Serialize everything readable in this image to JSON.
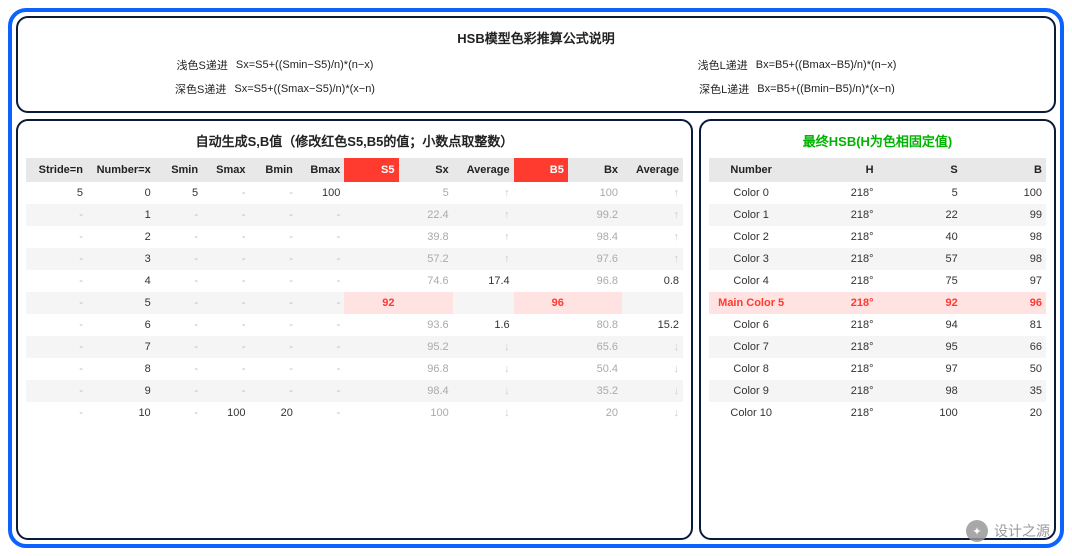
{
  "top": {
    "title": "HSB模型色彩推算公式说明",
    "formulas": [
      {
        "label": "浅色S递进",
        "text": "Sx=S5+((Smin−S5)/n)*(n−x)"
      },
      {
        "label": "浅色L递进",
        "text": "Bx=B5+((Bmax−B5)/n)*(n−x)"
      },
      {
        "label": "深色S递进",
        "text": "Sx=S5+((Smax−S5)/n)*(x−n)"
      },
      {
        "label": "深色L递进",
        "text": "Bx=B5+((Bmin−B5)/n)*(x−n)"
      }
    ]
  },
  "left": {
    "title": "自动生成S,B值（修改红色S5,B5的值；小数点取整数）",
    "headers": [
      "Stride=n",
      "Number=x",
      "Smin",
      "Smax",
      "Bmin",
      "Bmax",
      "S5",
      "Sx",
      "Average",
      "B5",
      "Bx",
      "Average"
    ],
    "rows": [
      {
        "stride": "5",
        "num": "0",
        "smin": "5",
        "smax": "-",
        "bmin": "-",
        "bmax": "100",
        "s5": "",
        "sx": "5",
        "savg": "↑",
        "b5": "",
        "bx": "100",
        "bavg": "↑"
      },
      {
        "stride": "-",
        "num": "1",
        "smin": "-",
        "smax": "-",
        "bmin": "-",
        "bmax": "-",
        "s5": "",
        "sx": "22.4",
        "savg": "↑",
        "b5": "",
        "bx": "99.2",
        "bavg": "↑"
      },
      {
        "stride": "-",
        "num": "2",
        "smin": "-",
        "smax": "-",
        "bmin": "-",
        "bmax": "-",
        "s5": "",
        "sx": "39.8",
        "savg": "↑",
        "b5": "",
        "bx": "98.4",
        "bavg": "↑"
      },
      {
        "stride": "-",
        "num": "3",
        "smin": "-",
        "smax": "-",
        "bmin": "-",
        "bmax": "-",
        "s5": "",
        "sx": "57.2",
        "savg": "↑",
        "b5": "",
        "bx": "97.6",
        "bavg": "↑"
      },
      {
        "stride": "-",
        "num": "4",
        "smin": "-",
        "smax": "-",
        "bmin": "-",
        "bmax": "-",
        "s5": "",
        "sx": "74.6",
        "savg": "17.4",
        "b5": "",
        "bx": "96.8",
        "bavg": "0.8"
      },
      {
        "stride": "-",
        "num": "5",
        "smin": "-",
        "smax": "-",
        "bmin": "-",
        "bmax": "-",
        "s5": "92",
        "sx": "",
        "savg": "",
        "b5": "96",
        "bx": "",
        "bavg": ""
      },
      {
        "stride": "-",
        "num": "6",
        "smin": "-",
        "smax": "-",
        "bmin": "-",
        "bmax": "-",
        "s5": "",
        "sx": "93.6",
        "savg": "1.6",
        "b5": "",
        "bx": "80.8",
        "bavg": "15.2"
      },
      {
        "stride": "-",
        "num": "7",
        "smin": "-",
        "smax": "-",
        "bmin": "-",
        "bmax": "-",
        "s5": "",
        "sx": "95.2",
        "savg": "↓",
        "b5": "",
        "bx": "65.6",
        "bavg": "↓"
      },
      {
        "stride": "-",
        "num": "8",
        "smin": "-",
        "smax": "-",
        "bmin": "-",
        "bmax": "-",
        "s5": "",
        "sx": "96.8",
        "savg": "↓",
        "b5": "",
        "bx": "50.4",
        "bavg": "↓"
      },
      {
        "stride": "-",
        "num": "9",
        "smin": "-",
        "smax": "-",
        "bmin": "-",
        "bmax": "-",
        "s5": "",
        "sx": "98.4",
        "savg": "↓",
        "b5": "",
        "bx": "35.2",
        "bavg": "↓"
      },
      {
        "stride": "-",
        "num": "10",
        "smin": "-",
        "smax": "100",
        "bmin": "20",
        "bmax": "-",
        "s5": "",
        "sx": "100",
        "savg": "↓",
        "b5": "",
        "bx": "20",
        "bavg": "↓"
      }
    ]
  },
  "right": {
    "title": "最终HSB(H为色相固定值)",
    "headers": [
      "Number",
      "H",
      "S",
      "B"
    ],
    "rows": [
      {
        "n": "Color 0",
        "h": "218°",
        "s": "5",
        "b": "100"
      },
      {
        "n": "Color 1",
        "h": "218°",
        "s": "22",
        "b": "99"
      },
      {
        "n": "Color 2",
        "h": "218°",
        "s": "40",
        "b": "98"
      },
      {
        "n": "Color 3",
        "h": "218°",
        "s": "57",
        "b": "98"
      },
      {
        "n": "Color 4",
        "h": "218°",
        "s": "75",
        "b": "97"
      },
      {
        "n": "Main Color 5",
        "h": "218°",
        "s": "92",
        "b": "96",
        "main": true
      },
      {
        "n": "Color 6",
        "h": "218°",
        "s": "94",
        "b": "81"
      },
      {
        "n": "Color 7",
        "h": "218°",
        "s": "95",
        "b": "66"
      },
      {
        "n": "Color 8",
        "h": "218°",
        "s": "97",
        "b": "50"
      },
      {
        "n": "Color 9",
        "h": "218°",
        "s": "98",
        "b": "35"
      },
      {
        "n": "Color 10",
        "h": "218°",
        "s": "100",
        "b": "20"
      }
    ]
  },
  "watermark": "设计之源"
}
